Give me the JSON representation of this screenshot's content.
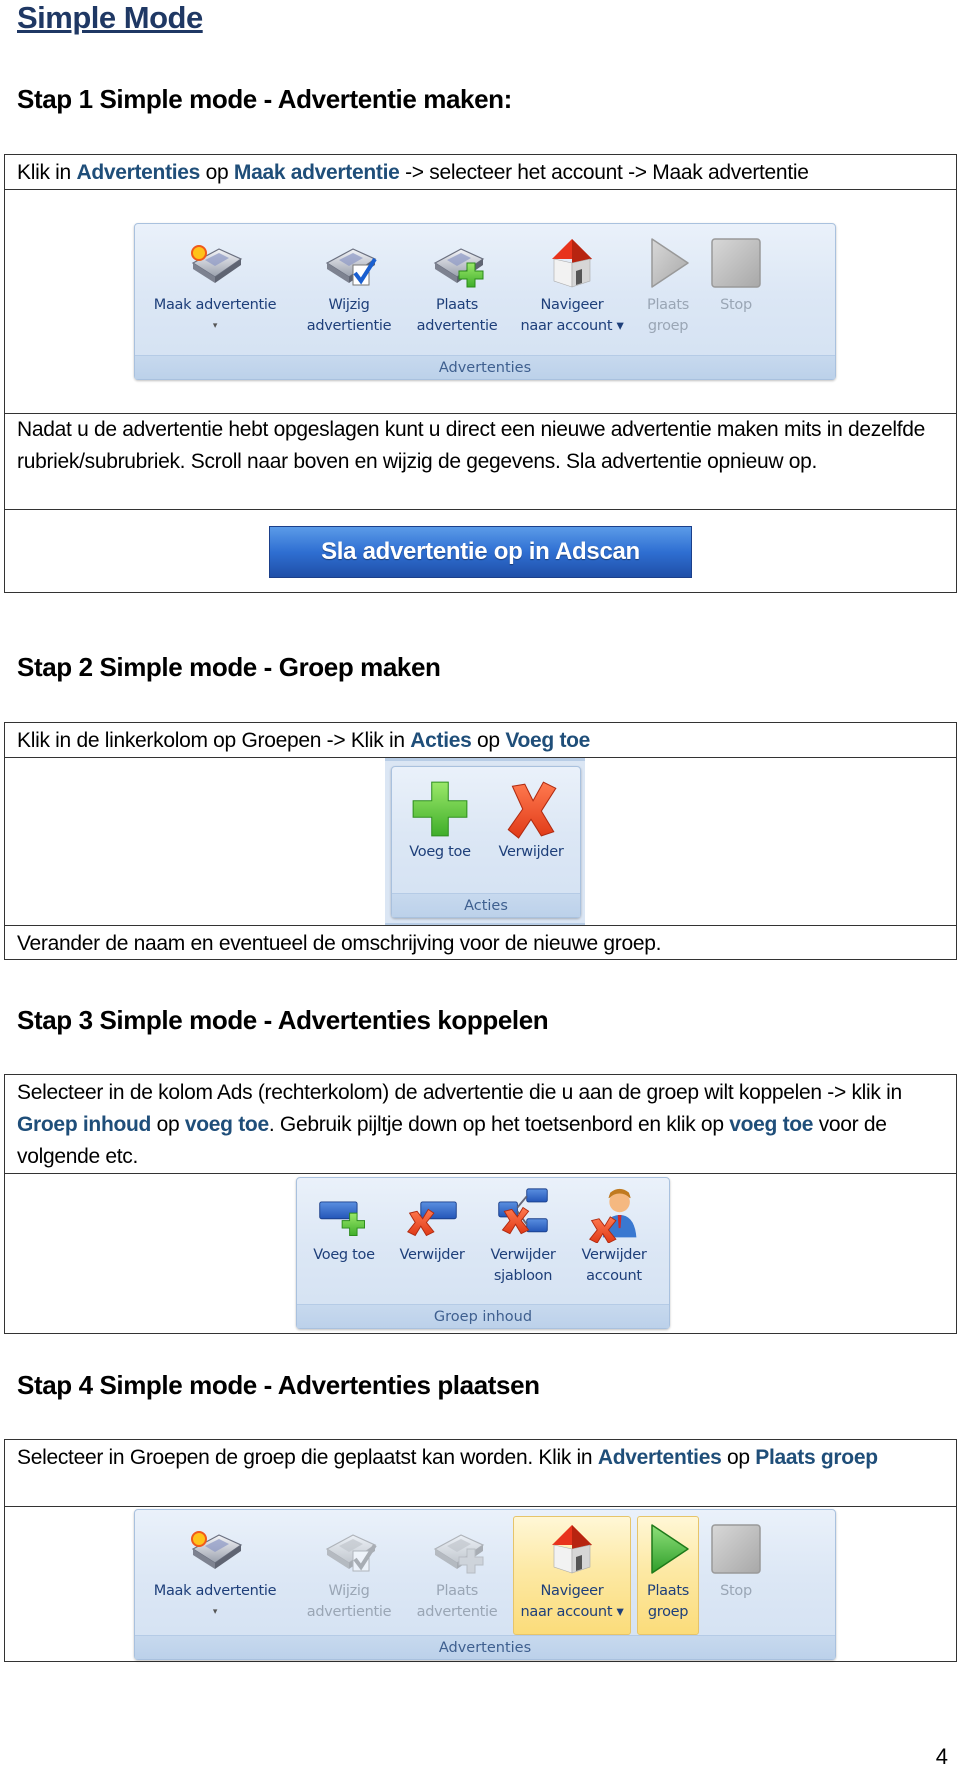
{
  "page_title": "Simple Mode",
  "page_number": "4",
  "step1": {
    "heading": "Stap 1 Simple mode - Advertentie maken:",
    "instruction": {
      "pre": "Klik in ",
      "hl1": "Advertenties",
      "mid": " op ",
      "hl2": "Maak advertentie",
      "post": " -> selecteer het account -> Maak advertentie"
    },
    "ribbon": {
      "group_label": "Advertenties",
      "buttons": [
        {
          "line1": "Maak advertentie",
          "line2": "▾",
          "icon": "newspaper-new-icon",
          "state": "enabled"
        },
        {
          "line1": "Wijzig",
          "line2": "advertientie",
          "icon": "newspaper-edit-icon",
          "state": "enabled"
        },
        {
          "line1": "Plaats",
          "line2": "advertentie",
          "icon": "newspaper-add-icon",
          "state": "enabled"
        },
        {
          "line1": "Navigeer",
          "line2": "naar account ▾",
          "icon": "house-icon",
          "state": "enabled"
        },
        {
          "line1": "Plaats",
          "line2": "groep",
          "icon": "play-icon",
          "state": "disabled"
        },
        {
          "line1": "Stop",
          "line2": "",
          "icon": "stop-icon",
          "state": "disabled"
        }
      ]
    },
    "note": "Nadat u de advertentie hebt opgeslagen kunt u direct een nieuwe advertentie maken mits in dezelfde rubriek/subrubriek. Scroll naar boven en wijzig de gegevens. Sla advertentie opnieuw op.",
    "save_button": "Sla advertentie op in Adscan"
  },
  "step2": {
    "heading": "Stap 2 Simple mode - Groep maken",
    "instruction": {
      "pre": "Klik in de linkerkolom op Groepen -> Klik in ",
      "hl1": "Acties",
      "mid": " op ",
      "hl2": "Voeg toe"
    },
    "ribbon": {
      "group_label": "Acties",
      "buttons": [
        {
          "line1": "Voeg toe",
          "icon": "plus-icon"
        },
        {
          "line1": "Verwijder",
          "icon": "delete-x-icon"
        }
      ]
    },
    "note": "Verander de naam en eventueel de omschrijving voor de nieuwe groep."
  },
  "step3": {
    "heading": "Stap 3 Simple mode - Advertenties koppelen",
    "instruction": {
      "pre": "Selecteer in de kolom Ads (rechterkolom) de advertentie die u aan de groep wilt koppelen -> klik in ",
      "hl1": "Groep inhoud",
      "mid": " op ",
      "hl2": "voeg toe",
      "mid2": ". Gebruik pijltje down op het toetsenbord en klik op ",
      "hl3": "voeg toe",
      "post": " voor de volgende etc."
    },
    "ribbon": {
      "group_label": "Groep inhoud",
      "buttons": [
        {
          "line1": "Voeg toe",
          "line2": "",
          "icon": "group-add-icon"
        },
        {
          "line1": "Verwijder",
          "line2": "",
          "icon": "group-remove-icon"
        },
        {
          "line1": "Verwijder",
          "line2": "sjabloon",
          "icon": "template-remove-icon"
        },
        {
          "line1": "Verwijder",
          "line2": "account",
          "icon": "account-remove-icon"
        }
      ]
    }
  },
  "step4": {
    "heading": "Stap 4 Simple mode - Advertenties plaatsen",
    "instruction": {
      "pre": "Selecteer in Groepen de groep die geplaatst kan worden. Klik in ",
      "hl1": "Advertenties",
      "mid": " op ",
      "hl2": "Plaats groep"
    },
    "ribbon": {
      "group_label": "Advertenties",
      "buttons": [
        {
          "line1": "Maak advertentie",
          "line2": "▾",
          "icon": "newspaper-new-icon",
          "state": "enabled"
        },
        {
          "line1": "Wijzig",
          "line2": "advertientie",
          "icon": "newspaper-edit-icon",
          "state": "disabled"
        },
        {
          "line1": "Plaats",
          "line2": "advertentie",
          "icon": "newspaper-add-icon",
          "state": "disabled"
        },
        {
          "line1": "Navigeer",
          "line2": "naar account ▾",
          "icon": "house-icon",
          "state": "highlighted"
        },
        {
          "line1": "Plaats",
          "line2": "groep",
          "icon": "play-icon",
          "state": "highlighted"
        },
        {
          "line1": "Stop",
          "line2": "",
          "icon": "stop-icon",
          "state": "disabled"
        }
      ]
    }
  }
}
